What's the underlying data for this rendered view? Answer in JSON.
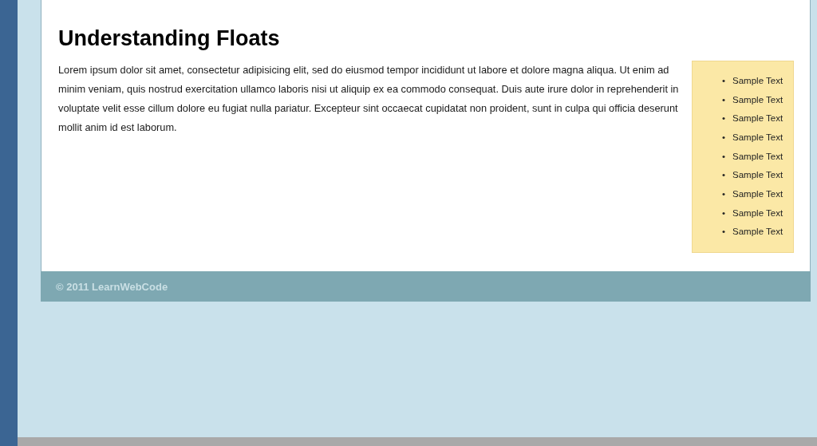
{
  "page": {
    "heading": "Understanding Floats",
    "paragraph": "Lorem ipsum dolor sit amet, consectetur adipisicing elit, sed do eiusmod tempor incididunt ut labore et dolore magna aliqua. Ut enim ad minim veniam, quis nostrud exercitation ullamco laboris nisi ut aliquip ex ea commodo consequat. Duis aute irure dolor in reprehenderit in voluptate velit esse cillum dolore eu fugiat nulla pariatur. Excepteur sint occaecat cupidatat non proident, sunt in culpa qui officia deserunt mollit anim id est laborum.",
    "sidebar_items": [
      {
        "bullet": "•",
        "text": "Sample Text"
      },
      {
        "bullet": "•",
        "text": "Sample Text"
      },
      {
        "bullet": "•",
        "text": "Sample Text"
      },
      {
        "bullet": "•",
        "text": "Sample Text"
      },
      {
        "bullet": "•",
        "text": "Sample Text"
      },
      {
        "bullet": "•",
        "text": "Sample Text"
      },
      {
        "bullet": "•",
        "text": "Sample Text"
      },
      {
        "bullet": "•",
        "text": "Sample Text"
      },
      {
        "bullet": "•",
        "text": "Sample Text"
      }
    ],
    "footer": "© 2011 LearnWebCode"
  }
}
